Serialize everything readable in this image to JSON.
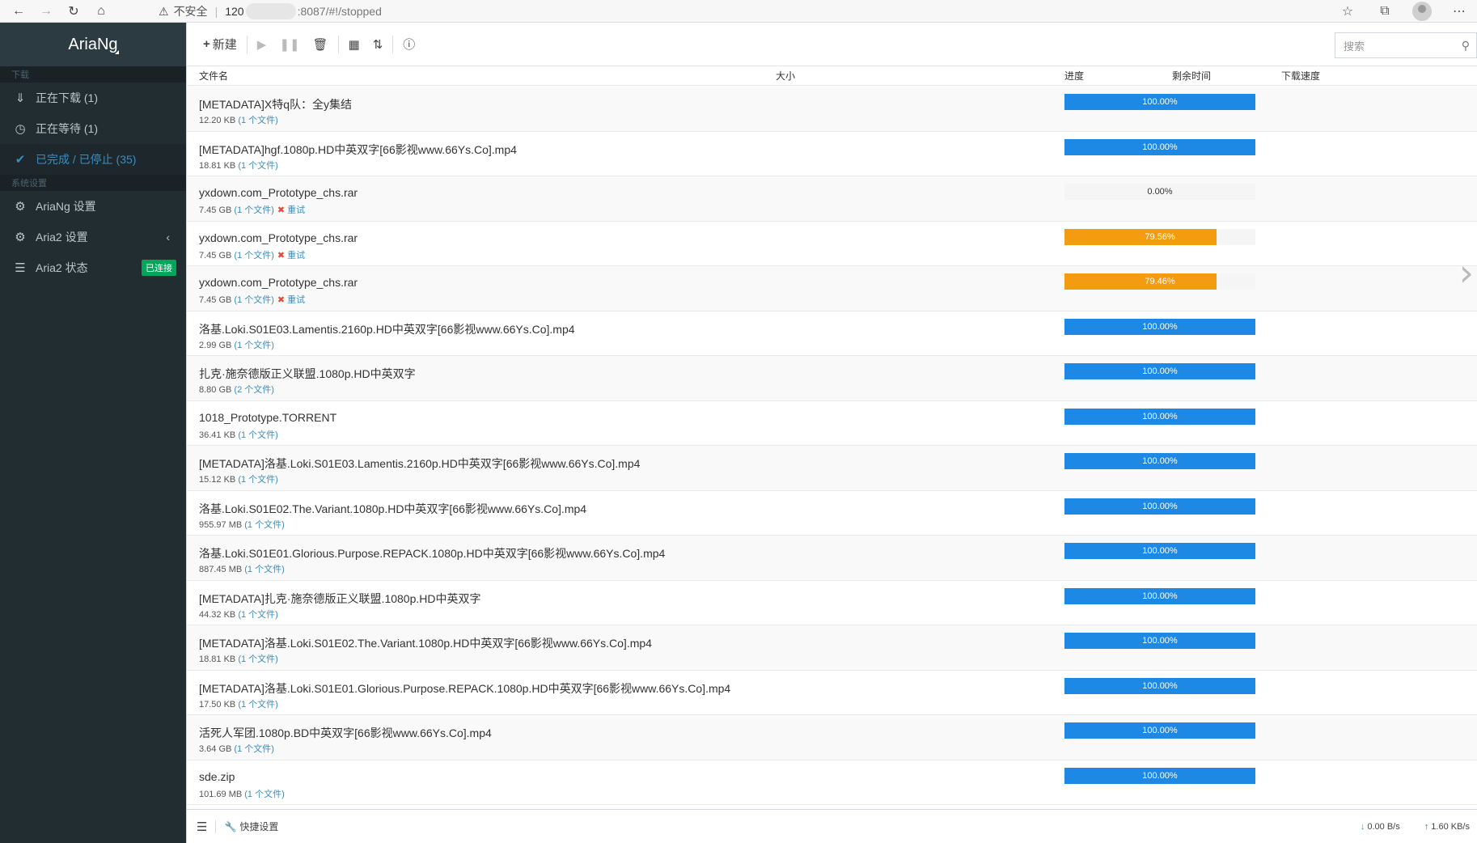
{
  "browser": {
    "security_label": "不安全",
    "url_host": "120",
    "url_path": ":8087/#!/stopped"
  },
  "sidebar": {
    "brand": "AriaNg",
    "section_download": "下载",
    "section_settings": "系统设置",
    "items": [
      {
        "label": "正在下载 (1)",
        "icon": "download-icon"
      },
      {
        "label": "正在等待 (1)",
        "icon": "clock-icon"
      },
      {
        "label": "已完成 / 已停止 (35)",
        "icon": "check-circle-icon",
        "active": true
      },
      {
        "label": "AriaNg 设置",
        "icon": "gear-icon"
      },
      {
        "label": "Aria2 设置",
        "icon": "gears-icon"
      },
      {
        "label": "Aria2 状态",
        "icon": "server-icon",
        "badge": "已连接"
      }
    ]
  },
  "toolbar": {
    "new_label": "新建",
    "search_placeholder": "搜索"
  },
  "table": {
    "headers": {
      "name": "文件名",
      "size": "大小",
      "progress": "进度",
      "remaining": "剩余时间",
      "speed": "下载速度"
    },
    "rows": [
      {
        "name": "[METADATA]X特q队：全y集结",
        "size": "12.20 KB",
        "files": "(1 个文件)",
        "progress": 100,
        "progress_label": "100.00%",
        "retry": false,
        "status": "complete"
      },
      {
        "name": "[METADATA]hgf.1080p.HD中英双字[66影视www.66Ys.Co].mp4",
        "size": "18.81 KB",
        "files": "(1 个文件)",
        "progress": 100,
        "progress_label": "100.00%",
        "retry": false,
        "status": "complete"
      },
      {
        "name": "yxdown.com_Prototype_chs.rar",
        "size": "7.45 GB",
        "files": "(1 个文件)",
        "progress": 0,
        "progress_label": "0.00%",
        "retry": true,
        "status": "error"
      },
      {
        "name": "yxdown.com_Prototype_chs.rar",
        "size": "7.45 GB",
        "files": "(1 个文件)",
        "progress": 79.56,
        "progress_label": "79.56%",
        "retry": true,
        "status": "error"
      },
      {
        "name": "yxdown.com_Prototype_chs.rar",
        "size": "7.45 GB",
        "files": "(1 个文件)",
        "progress": 79.46,
        "progress_label": "79.46%",
        "retry": true,
        "status": "error"
      },
      {
        "name": "洛基.Loki.S01E03.Lamentis.2160p.HD中英双字[66影视www.66Ys.Co].mp4",
        "size": "2.99 GB",
        "files": "(1 个文件)",
        "progress": 100,
        "progress_label": "100.00%",
        "retry": false,
        "status": "complete"
      },
      {
        "name": "扎克·施奈德版正义联盟.1080p.HD中英双字",
        "size": "8.80 GB",
        "files": "(2 个文件)",
        "progress": 100,
        "progress_label": "100.00%",
        "retry": false,
        "status": "complete"
      },
      {
        "name": "1018_Prototype.TORRENT",
        "size": "36.41 KB",
        "files": "(1 个文件)",
        "progress": 100,
        "progress_label": "100.00%",
        "retry": false,
        "status": "complete"
      },
      {
        "name": "[METADATA]洛基.Loki.S01E03.Lamentis.2160p.HD中英双字[66影视www.66Ys.Co].mp4",
        "size": "15.12 KB",
        "files": "(1 个文件)",
        "progress": 100,
        "progress_label": "100.00%",
        "retry": false,
        "status": "complete"
      },
      {
        "name": "洛基.Loki.S01E02.The.Variant.1080p.HD中英双字[66影视www.66Ys.Co].mp4",
        "size": "955.97 MB",
        "files": "(1 个文件)",
        "progress": 100,
        "progress_label": "100.00%",
        "retry": false,
        "status": "complete"
      },
      {
        "name": "洛基.Loki.S01E01.Glorious.Purpose.REPACK.1080p.HD中英双字[66影视www.66Ys.Co].mp4",
        "size": "887.45 MB",
        "files": "(1 个文件)",
        "progress": 100,
        "progress_label": "100.00%",
        "retry": false,
        "status": "complete"
      },
      {
        "name": "[METADATA]扎克·施奈德版正义联盟.1080p.HD中英双字",
        "size": "44.32 KB",
        "files": "(1 个文件)",
        "progress": 100,
        "progress_label": "100.00%",
        "retry": false,
        "status": "complete"
      },
      {
        "name": "[METADATA]洛基.Loki.S01E02.The.Variant.1080p.HD中英双字[66影视www.66Ys.Co].mp4",
        "size": "18.81 KB",
        "files": "(1 个文件)",
        "progress": 100,
        "progress_label": "100.00%",
        "retry": false,
        "status": "complete"
      },
      {
        "name": "[METADATA]洛基.Loki.S01E01.Glorious.Purpose.REPACK.1080p.HD中英双字[66影视www.66Ys.Co].mp4",
        "size": "17.50 KB",
        "files": "(1 个文件)",
        "progress": 100,
        "progress_label": "100.00%",
        "retry": false,
        "status": "complete"
      },
      {
        "name": "活死人军团.1080p.BD中英双字[66影视www.66Ys.Co].mp4",
        "size": "3.64 GB",
        "files": "(1 个文件)",
        "progress": 100,
        "progress_label": "100.00%",
        "retry": false,
        "status": "complete"
      },
      {
        "name": "sde.zip",
        "size": "101.69 MB",
        "files": "(1 个文件)",
        "progress": 100,
        "progress_label": "100.00%",
        "retry": false,
        "status": "complete"
      }
    ],
    "retry_label": "重试"
  },
  "footer": {
    "quick_settings": "快捷设置",
    "download_speed": "0.00 B/s",
    "upload_speed": "1.60 KB/s"
  },
  "colors": {
    "progress_complete": "#1e88e5",
    "progress_error": "#f39c12",
    "sidebar_bg": "#222d32",
    "accent": "#3c8dbc",
    "badge": "#00a65a"
  }
}
